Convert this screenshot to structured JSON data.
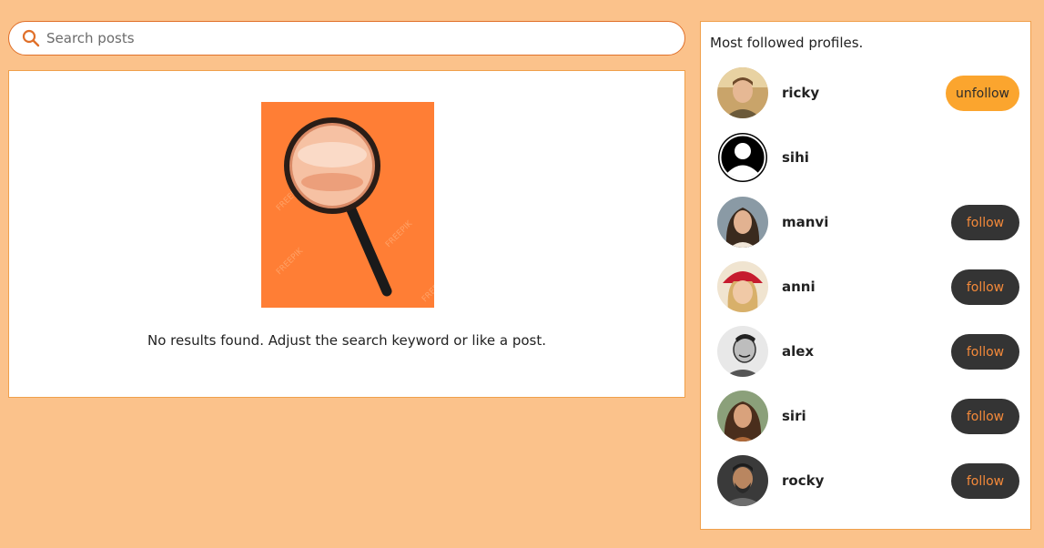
{
  "search": {
    "placeholder": "Search posts",
    "value": ""
  },
  "results": {
    "empty_message": "No results found. Adjust the search keyword or like a post.",
    "watermark": "FREEPIK"
  },
  "profiles": {
    "title": "Most followed profiles.",
    "items": [
      {
        "name": "ricky",
        "button": "unfollow"
      },
      {
        "name": "sihi",
        "button": ""
      },
      {
        "name": "manvi",
        "button": "follow"
      },
      {
        "name": "anni",
        "button": "follow"
      },
      {
        "name": "alex",
        "button": "follow"
      },
      {
        "name": "siri",
        "button": "follow"
      },
      {
        "name": "rocky",
        "button": "follow"
      }
    ]
  },
  "colors": {
    "background": "#fbc28b",
    "accent": "#e0702a",
    "follow_bg": "#343434",
    "follow_text": "#f58a3a",
    "unfollow_bg": "#fba52e"
  }
}
